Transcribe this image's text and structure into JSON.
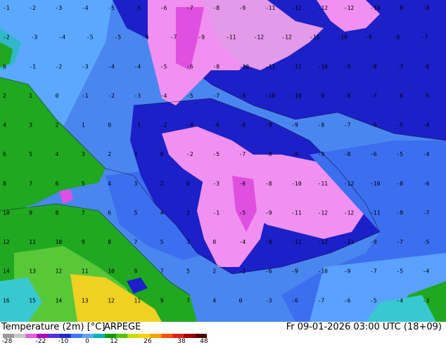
{
  "map": {
    "field_name": "Temperature (2m)",
    "unit": "[°C]",
    "model": "ARPEGE",
    "validity": "Fr 09-01-2026 03:00 UTC (18+09)",
    "grid_label_rows": [
      "-1 -2 -3 -4 -5 -5 -6 -7 -8 -9 -11 -12 -12 -12 -10 -9 -8",
      "-2 -3 -4 -5 -5 -6 -7 -9 -11 -12 -12 -11 -10 -9 -8 -7",
      "0 -1 -2 -3 -4 -4 -5 -6 -8 -10 -11 -11 -10 -9 -8 -7 -6",
      "2 1 0 -1 -2 -3 -4 -5 -7 -9 -10 -10 -9 -8 -7 -6 -5",
      "4 3 2 1 0 -1 -2 -4 -6 -8 -9 -9 -8 -7 -6 -5 -4",
      "6 5 4 3 2 1 0 -2 -5 -7 -8 -9 -9 -8 -6 -5 -4",
      "8 7 6 5 4 3 2 0 -3 -6 -8 -10 -11 -12 -10 -8 -6",
      "10 9 8 7 6 5 4 2 -1 -5 -9 -11 -12 -12 -11 -9 -7",
      "12 11 10 9 8 7 5 3 0 -4 -8 -11 -12 -11 -9 -7 -5",
      "14 13 12 11 10 9 7 5 2 -2 -6 -9 -10 -9 -7 -5 -4",
      "16 15 14 13 12 11 9 7 4 0 -3 -6 -7 -6 -5 -4 -3"
    ]
  },
  "legend": {
    "ticks": [
      "-28",
      "-22",
      "-10",
      "0",
      "12",
      "26",
      "38",
      "48"
    ],
    "colors": [
      "#9a9a9a",
      "#c8c8c8",
      "#e060e0",
      "#b000c0",
      "#5030e0",
      "#1e2cc8",
      "#3c78ff",
      "#5aa8ff",
      "#00b4b4",
      "#00a000",
      "#50c800",
      "#c8dc00",
      "#ffd200",
      "#ffa000",
      "#ff5000",
      "#e01e1e",
      "#a00000",
      "#500000"
    ]
  },
  "colors": {
    "very_cold": "#1c20c8",
    "cold_pink": "#f090f0",
    "magenta": "#e050e0",
    "cool_blue": "#3c6ef0",
    "mild_blue": "#5aa0ff",
    "cyan": "#38c8d0",
    "green": "#18a818",
    "light_green": "#58c838",
    "yellow": "#f0d020"
  }
}
